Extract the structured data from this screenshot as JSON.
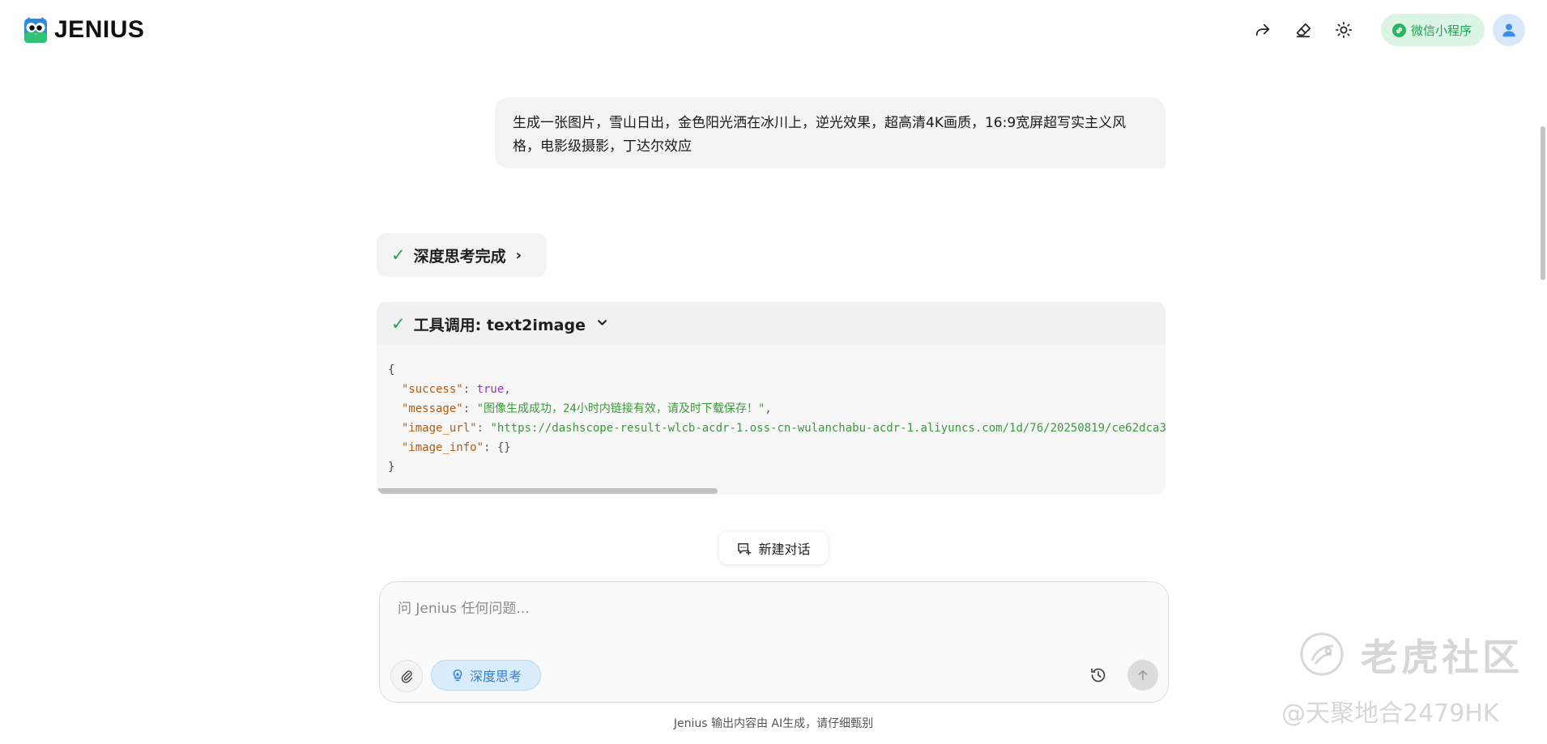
{
  "app": {
    "name": "JENIUS"
  },
  "header": {
    "wechat_label": "微信小程序"
  },
  "conversation": {
    "user_message": "生成一张图片，雪山日出，金色阳光洒在冰川上，逆光效果，超高清4K画质，16:9宽屏超写实主义风格，电影级摄影，丁达尔效应",
    "thinking_label": "深度思考完成",
    "tool_call_label": "工具调用: text2image",
    "tool_output": {
      "open": "{",
      "close": "}",
      "lines": [
        {
          "key": "\"success\"",
          "value": "true",
          "type": "bool",
          "comma": ","
        },
        {
          "key": "\"message\"",
          "value": "\"图像生成成功，24小时内链接有效，请及时下载保存！\"",
          "type": "string",
          "comma": ","
        },
        {
          "key": "\"image_url\"",
          "value": "\"https://dashscope-result-wlcb-acdr-1.oss-cn-wulanchabu-acdr-1.aliyuncs.com/1d/76/20250819/ce62dca3/",
          "type": "string",
          "comma": ""
        },
        {
          "key": "\"image_info\"",
          "value": "{}",
          "type": "punct",
          "comma": ""
        }
      ]
    }
  },
  "new_chat_label": "新建对话",
  "composer": {
    "placeholder": "问 Jenius 任何问题...",
    "value": "",
    "deep_think_label": "深度思考"
  },
  "disclaimer": "Jenius 输出内容由 AI生成，请仔细甄别",
  "watermark": {
    "title": "老虎社区",
    "subtitle": "@天聚地合2479HK"
  },
  "colors": {
    "accent_green": "#22a354",
    "accent_blue": "#2b80d0",
    "bubble_bg": "#f3f3f3",
    "wechat_bg": "#dbf4e3"
  },
  "icons": {
    "share": "share-icon",
    "eraser": "eraser-icon",
    "theme": "sun-icon",
    "wechat": "link-icon",
    "avatar": "user-icon",
    "attach": "paperclip-icon",
    "deep_think": "bulb-icon",
    "history": "history-icon",
    "send": "arrow-up-icon",
    "new_chat": "chat-add-icon"
  }
}
